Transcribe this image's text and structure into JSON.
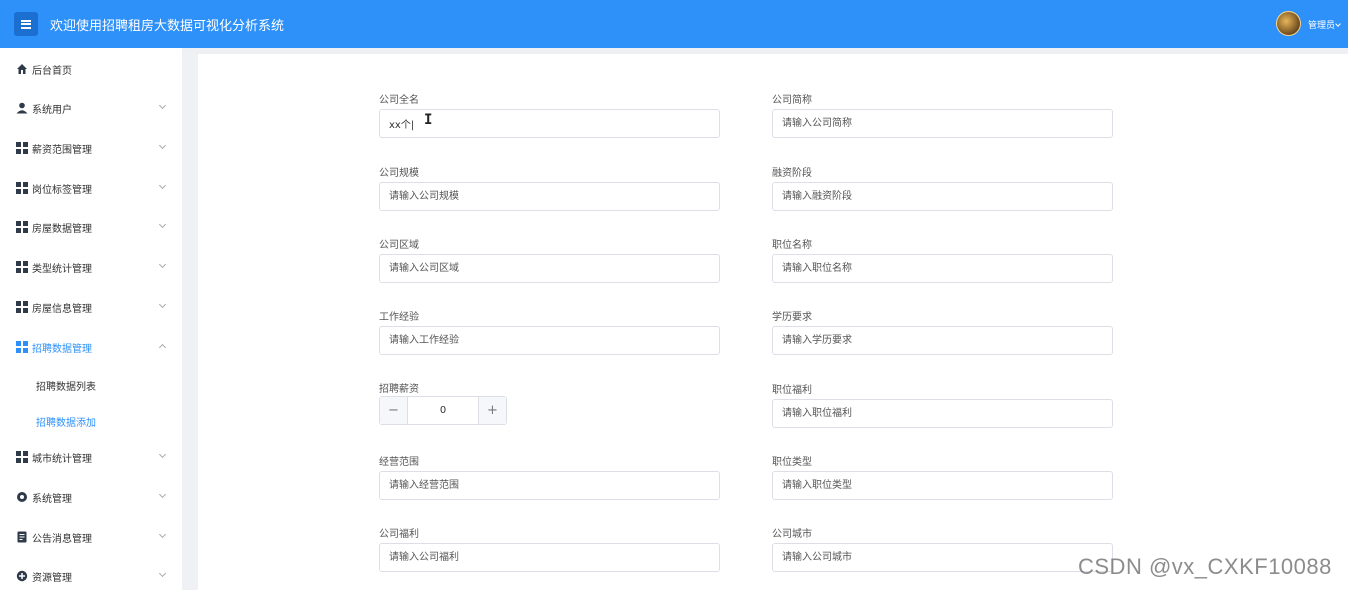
{
  "header": {
    "title": "欢迎使用招聘租房大数据可视化分析系统",
    "user_name": "管理员",
    "brand_color": "#2e90f9"
  },
  "sidebar": {
    "items": [
      {
        "label": "后台首页",
        "icon": "home-icon"
      },
      {
        "label": "系统用户",
        "icon": "user-icon"
      },
      {
        "label": "薪资范围管理",
        "icon": "grid-icon"
      },
      {
        "label": "岗位标签管理",
        "icon": "grid-icon"
      },
      {
        "label": "房屋数据管理",
        "icon": "grid-icon"
      },
      {
        "label": "类型统计管理",
        "icon": "grid-icon"
      },
      {
        "label": "房屋信息管理",
        "icon": "grid-icon"
      },
      {
        "label": "招聘数据管理",
        "icon": "grid-icon"
      },
      {
        "label": "城市统计管理",
        "icon": "grid-icon"
      },
      {
        "label": "系统管理",
        "icon": "gear-icon"
      },
      {
        "label": "公告消息管理",
        "icon": "document-icon"
      },
      {
        "label": "资源管理",
        "icon": "circle-icon"
      }
    ],
    "subitems": [
      {
        "label": "招聘数据列表"
      },
      {
        "label": "招聘数据添加"
      }
    ],
    "active_color": "#2e90f9"
  },
  "form": {
    "company_full_name": {
      "label": "公司全名",
      "value": "xx个|"
    },
    "company_short_name": {
      "label": "公司简称",
      "placeholder": "请输入公司简称"
    },
    "company_size": {
      "label": "公司规模",
      "placeholder": "请输入公司规模"
    },
    "financing_stage": {
      "label": "融资阶段",
      "placeholder": "请输入融资阶段"
    },
    "company_region": {
      "label": "公司区域",
      "placeholder": "请输入公司区域"
    },
    "position_name": {
      "label": "职位名称",
      "placeholder": "请输入职位名称"
    },
    "work_experience": {
      "label": "工作经验",
      "placeholder": "请输入工作经验"
    },
    "education": {
      "label": "学历要求",
      "placeholder": "请输入学历要求"
    },
    "salary": {
      "label": "招聘薪资",
      "value": "0",
      "minus": "−",
      "plus": "+"
    },
    "position_benefits": {
      "label": "职位福利",
      "placeholder": "请输入职位福利"
    },
    "business_scope": {
      "label": "经营范围",
      "placeholder": "请输入经营范围"
    },
    "position_type": {
      "label": "职位类型",
      "placeholder": "请输入职位类型"
    },
    "company_benefits": {
      "label": "公司福利",
      "placeholder": "请输入公司福利"
    },
    "company_city": {
      "label": "公司城市",
      "placeholder": "请输入公司城市"
    }
  },
  "cursor_glyph": "I",
  "watermark": "CSDN @vx_CXKF10088"
}
